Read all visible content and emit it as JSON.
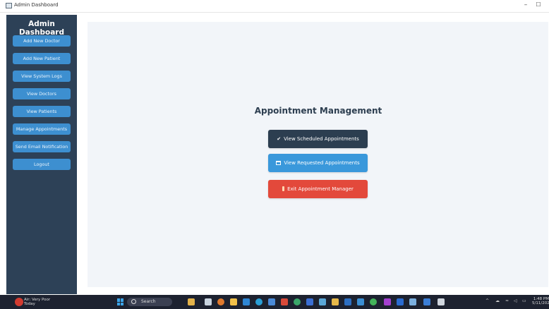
{
  "window": {
    "title": "Admin Dashboard"
  },
  "sidebar": {
    "heading": "Admin Dashboard",
    "items": [
      {
        "label": "Add New Doctor"
      },
      {
        "label": "Add New Patient"
      },
      {
        "label": "View System Logs"
      },
      {
        "label": "View Doctors"
      },
      {
        "label": "View Patients"
      },
      {
        "label": "Manage Appointments"
      },
      {
        "label": "Send Email Notification"
      },
      {
        "label": "Logout"
      }
    ]
  },
  "main": {
    "heading": "Appointment Management",
    "buttons": {
      "scheduled": "View Scheduled Appointments",
      "requested": "View Requested Appointments",
      "exit": "Exit Appointment Manager"
    }
  },
  "taskbar": {
    "weather_line1": "Air: Very Poor",
    "weather_line2": "Today",
    "search_label": "Search",
    "time": "1:48 PM",
    "date": "5/11/2025"
  },
  "colors": {
    "sidebar_bg": "#2d4157",
    "nav_button": "#3d8fd0",
    "btn_dark": "#2c3e50",
    "btn_blue": "#3a98db",
    "btn_red": "#e3493b",
    "main_bg": "#f2f5f9"
  }
}
